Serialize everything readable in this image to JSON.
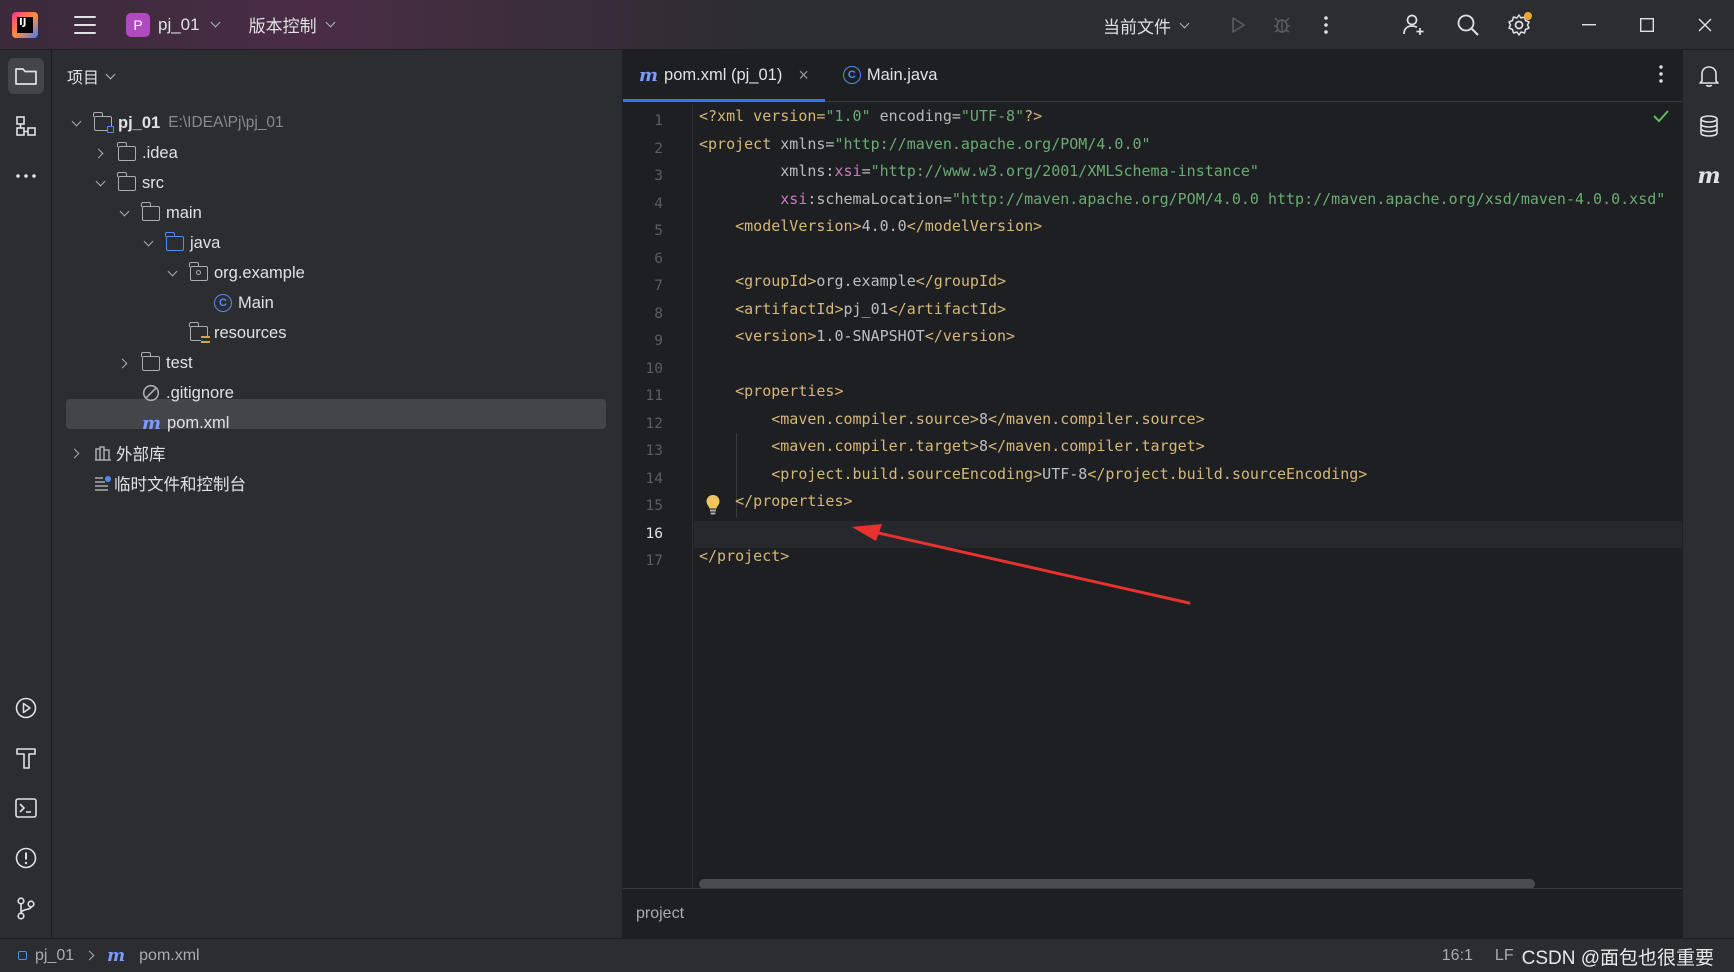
{
  "titlebar": {
    "project_badge": "P",
    "project_name": "pj_01",
    "vcs_label": "版本控制",
    "run_config": "当前文件"
  },
  "project_panel": {
    "header": "项目",
    "tree": [
      {
        "label": "pj_01",
        "path": "E:\\IDEA\\Pj\\pj_01",
        "kind": "module",
        "expanded": true
      },
      {
        "label": ".idea",
        "kind": "folder",
        "expanded": false
      },
      {
        "label": "src",
        "kind": "folder",
        "expanded": true
      },
      {
        "label": "main",
        "kind": "folder",
        "expanded": true
      },
      {
        "label": "java",
        "kind": "source-folder",
        "expanded": true
      },
      {
        "label": "org.example",
        "kind": "package",
        "expanded": true
      },
      {
        "label": "Main",
        "kind": "class"
      },
      {
        "label": "resources",
        "kind": "resources-folder"
      },
      {
        "label": "test",
        "kind": "folder",
        "expanded": false
      },
      {
        "label": ".gitignore",
        "kind": "ignore-file"
      },
      {
        "label": "pom.xml",
        "kind": "maven-file",
        "selected": true
      },
      {
        "label": "外部库",
        "kind": "libraries",
        "expanded": false
      },
      {
        "label": "临时文件和控制台",
        "kind": "scratches"
      }
    ]
  },
  "editor": {
    "tabs": [
      {
        "label": "pom.xml (pj_01)",
        "active": true,
        "icon": "maven-icon",
        "close": "×"
      },
      {
        "label": "Main.java",
        "active": false,
        "icon": "class-icon"
      }
    ],
    "line_numbers": [
      "1",
      "2",
      "3",
      "4",
      "5",
      "6",
      "7",
      "8",
      "9",
      "10",
      "11",
      "12",
      "13",
      "14",
      "15",
      "16",
      "17"
    ],
    "current_line": "16",
    "code": {
      "l1": {
        "p1": "<?xml version=",
        "p2": "\"1.0\"",
        "p3": " encoding=",
        "p4": "\"UTF-8\"",
        "p5": "?>"
      },
      "l2": {
        "p1": "<project",
        "p2": " xmlns=",
        "p3": "\"http://maven.apache.org/POM/4.0.0\""
      },
      "l3": {
        "p1": "         xmlns:",
        "p2": "xsi",
        "p3": "=",
        "p4": "\"http://www.w3.org/2001/XMLSchema-instance\""
      },
      "l4": {
        "p1": "         ",
        "p2": "xsi",
        "p3": ":schemaLocation=",
        "p4": "\"http://maven.apache.org/POM/4.0.0 http://maven.apache.org/xsd/maven-4.0.0.xsd\""
      },
      "l5": {
        "p1": "    <modelVersion>",
        "p2": "4.0.0",
        "p3": "</modelVersion>"
      },
      "l7": {
        "p1": "    <groupId>",
        "p2": "org.example",
        "p3": "</groupId>"
      },
      "l8": {
        "p1": "    <artifactId>",
        "p2": "pj_01",
        "p3": "</artifactId>"
      },
      "l9": {
        "p1": "    <version>",
        "p2": "1.0-SNAPSHOT",
        "p3": "</version>"
      },
      "l11": {
        "p1": "    <properties>"
      },
      "l12": {
        "p1": "        <maven.compiler.source>",
        "p2": "8",
        "p3": "</maven.compiler.source>"
      },
      "l13": {
        "p1": "        <maven.compiler.target>",
        "p2": "8",
        "p3": "</maven.compiler.target>"
      },
      "l14": {
        "p1": "        <project.build.sourceEncoding>",
        "p2": "UTF-8",
        "p3": "</project.build.sourceEncoding>"
      },
      "l15": {
        "p1": "    </properties>"
      },
      "l17": {
        "p1": "</project>"
      }
    },
    "breadcrumb": "project"
  },
  "statusbar": {
    "module": "pj_01",
    "file": "pom.xml",
    "position": "16:1",
    "line_separator": "LF",
    "watermark": "CSDN @面包也很重要"
  },
  "colors": {
    "accent": "#3574f0",
    "tag": "#d5b778",
    "string": "#6aab73",
    "annotation_arrow": "#e8322f"
  }
}
